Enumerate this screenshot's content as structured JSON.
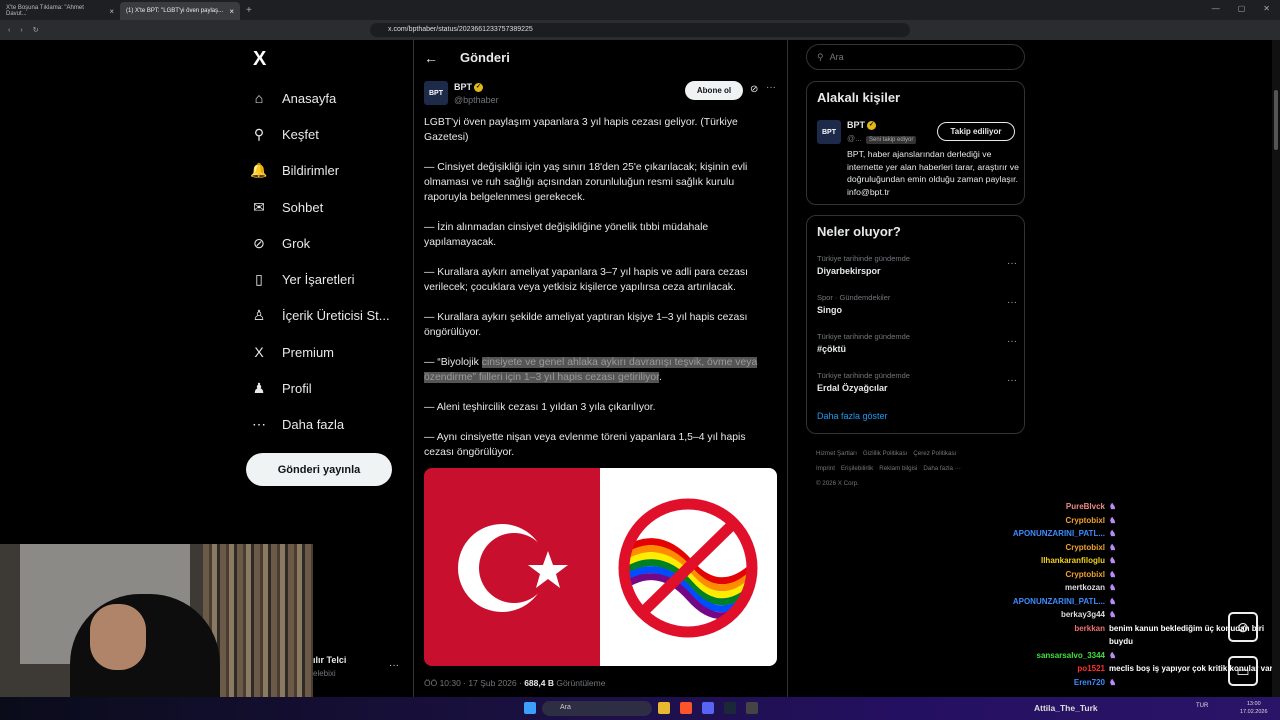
{
  "browser": {
    "tabs": [
      {
        "label": "X'te Boşuna Tıklama: \"Ahmet Davut..."
      },
      {
        "label": "(1) X'te BPT: \"LGBT'yi öven paylaş..."
      }
    ],
    "url": "x.com/bpthaber/status/2023661233757389225",
    "new_tab": "+"
  },
  "sidebar": {
    "logo": "X",
    "items": [
      {
        "icon": "home-icon",
        "label": "Anasayfa",
        "glyph": "⌂"
      },
      {
        "icon": "search-icon",
        "label": "Keşfet",
        "glyph": "⚲"
      },
      {
        "icon": "bell-icon",
        "label": "Bildirimler",
        "glyph": "🔔"
      },
      {
        "icon": "mail-icon",
        "label": "Sohbet",
        "glyph": "✉"
      },
      {
        "icon": "grok-icon",
        "label": "Grok",
        "glyph": "⊘"
      },
      {
        "icon": "bookmark-icon",
        "label": "Yer İşaretleri",
        "glyph": "▯"
      },
      {
        "icon": "creator-icon",
        "label": "İçerik Üreticisi St...",
        "glyph": "♙"
      },
      {
        "icon": "premium-icon",
        "label": "Premium",
        "glyph": "X"
      },
      {
        "icon": "profile-icon",
        "label": "Profil",
        "glyph": "♟"
      },
      {
        "icon": "more-icon",
        "label": "Daha fazla",
        "glyph": "⋯"
      }
    ],
    "post_button": "Gönderi yayınla",
    "notification_badge": "1",
    "account_name": "ılır Telci",
    "account_handle": "elebixi"
  },
  "main": {
    "header": "Gönderi",
    "author": {
      "name": "BPT",
      "handle": "@bpthaber",
      "avatar": "BPT"
    },
    "subscribe": "Abone ol",
    "paragraphs": [
      "LGBT'yi öven paylaşım yapanlara 3 yıl hapis cezası geliyor. (Türkiye Gazetesi)",
      "— Cinsiyet değişikliği için yaş sınırı 18'den 25'e çıkarılacak; kişinin evli olmaması ve ruh sağlığı açısından zorunluluğun resmi sağlık kurulu raporuyla belgelenmesi gerekecek.",
      "— İzin alınmadan cinsiyet değişikliğine yönelik tıbbi müdahale yapılamayacak.",
      "— Kurallara aykırı ameliyat yapanlara 3–7 yıl hapis ve adli para cezası verilecek; çocuklara veya yetkisiz kişilerce yapılırsa ceza artırılacak.",
      "— Kurallara aykırı şekilde ameliyat yaptıran kişiye 1–3 yıl hapis cezası öngörülüyor."
    ],
    "para6_start": "— “Biyolojik ",
    "para6_selected": "cinsiyete ve genel ahlaka aykırı davranışı teşvik, övme veya özendirme” fiilleri için 1–3 yıl hapis cezası getiriliyor",
    "para6_end": ".",
    "paragraphs_after": [
      "— Aleni teşhircilik cezası 1 yıldan 3 yıla çıkarılıyor.",
      "— Aynı cinsiyette nişan veya evlenme töreni yapanlara 1,5–4 yıl hapis cezası öngörülüyor."
    ],
    "meta_time": "ÖÖ 10:30 · 17 Şub 2026 · ",
    "meta_views": "688,4 B",
    "meta_views_label": " Görüntüleme"
  },
  "right": {
    "search_placeholder": "Ara",
    "related_title": "Alakalı kişiler",
    "related": {
      "name": "BPT",
      "handle": "@...",
      "badge": "Seni takip ediyor",
      "follow": "Takip ediliyor",
      "bio": "BPT, haber ajanslarından derlediği ve internette yer alan haberleri tarar, araştırır ve doğruluğundan emin olduğu zaman paylaşır. info@bpt.tr"
    },
    "trends_title": "Neler oluyor?",
    "trends": [
      {
        "cat": "Türkiye tarihinde gündemde",
        "name": "Diyarbekirspor"
      },
      {
        "cat": "Spor · Gündemdekiler",
        "name": "Singo"
      },
      {
        "cat": "Türkiye tarihinde gündemde",
        "name": "#çöktü"
      },
      {
        "cat": "Türkiye tarihinde gündemde",
        "name": "Erdal Özyağcılar"
      }
    ],
    "show_more": "Daha fazla göster",
    "footer": [
      "Hizmet Şartları",
      "Gizlilik Politikası",
      "Çerez Politikası",
      "Imprint",
      "Erişilebilirlik",
      "Reklam bilgisi",
      "Daha fazla ···",
      "© 2026 X Corp."
    ]
  },
  "chat": [
    {
      "u": "PureBlvck",
      "c": "#e88",
      "m": ""
    },
    {
      "u": "Cryptobixl",
      "c": "#f0a030",
      "m": ""
    },
    {
      "u": "APONUNZARINI_PATL...",
      "c": "#3c8cff",
      "m": ""
    },
    {
      "u": "Cryptobixl",
      "c": "#f0a030",
      "m": ""
    },
    {
      "u": "Ilhankaranfiloglu",
      "c": "#f0d020",
      "m": ""
    },
    {
      "u": "Cryptobixl",
      "c": "#f0a030",
      "m": ""
    },
    {
      "u": "mertkozan",
      "c": "#ddd",
      "m": ""
    },
    {
      "u": "APONUNZARINI_PATL...",
      "c": "#3c8cff",
      "m": ""
    },
    {
      "u": "berkay3g44",
      "c": "#ddd",
      "m": ""
    },
    {
      "u": "berkkan",
      "c": "#f07070",
      "m": "benim kanun beklediğim üç konudan biri buydu"
    },
    {
      "u": "sansarsalvo_3344",
      "c": "#40e040",
      "m": ""
    },
    {
      "u": "po1521",
      "c": "#ff3030",
      "m": "meclis boş iş yapıyor çok kritik konular var"
    },
    {
      "u": "Eren720",
      "c": "#3c8cff",
      "m": ""
    }
  ],
  "taskbar": {
    "search": "Ara",
    "streamer": "Attila_The_Turk",
    "lang": "TUR",
    "time": "13:00",
    "date": "17.02.2026"
  }
}
